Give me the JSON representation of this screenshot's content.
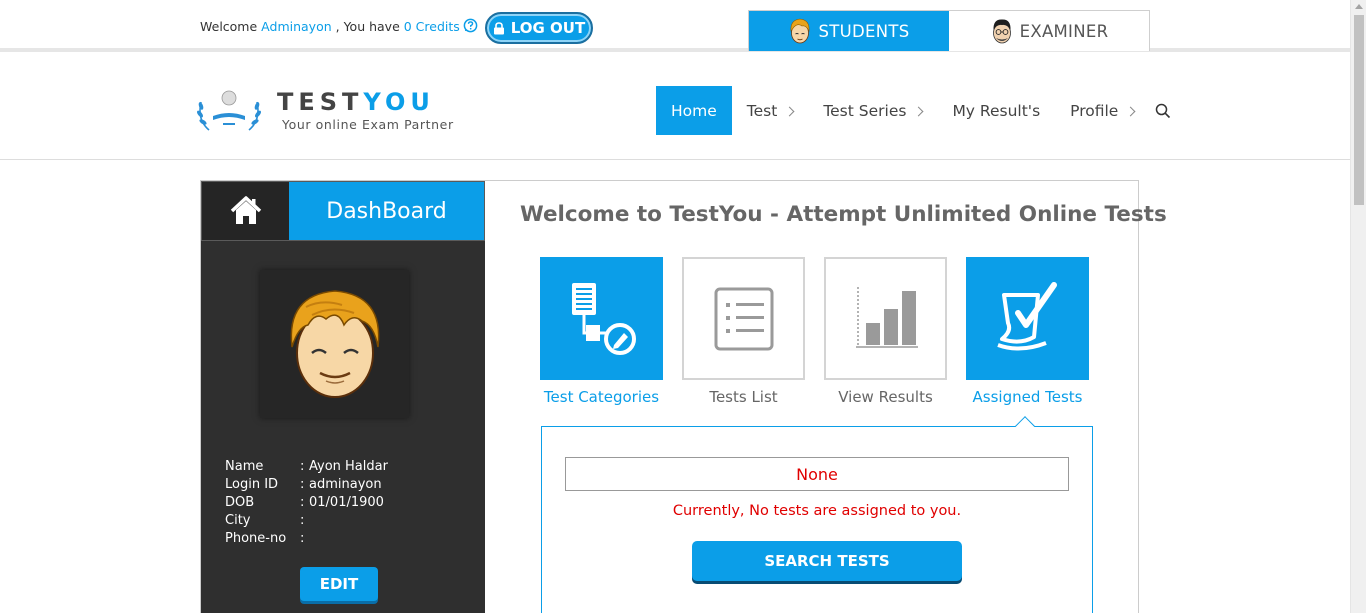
{
  "topbar": {
    "welcome_prefix": "Welcome",
    "username": "Adminayon",
    "have_text": ", You have",
    "credits": "0 Credits",
    "credits_suffix": ".",
    "logout_label": "LOG OUT"
  },
  "roles": {
    "students_label": "STUDENTS",
    "examiner_label": "EXAMINER"
  },
  "logo": {
    "brand_part1": "TEST",
    "brand_part2": "YOU",
    "tagline": "Your online Exam Partner"
  },
  "nav": {
    "items": [
      {
        "label": "Home"
      },
      {
        "label": "Test"
      },
      {
        "label": "Test Series"
      },
      {
        "label": "My Result's"
      },
      {
        "label": "Profile"
      }
    ]
  },
  "sidebar": {
    "title": "DashBoard",
    "profile": [
      {
        "label": "Name",
        "value": "Ayon Haldar"
      },
      {
        "label": "Login ID",
        "value": "adminayon"
      },
      {
        "label": "DOB",
        "value": "01/01/1900"
      },
      {
        "label": "City",
        "value": ""
      },
      {
        "label": "Phone-no",
        "value": ""
      }
    ],
    "separator": ":",
    "edit_label": "EDIT"
  },
  "main": {
    "title": "Welcome to TestYou - Attempt Unlimited Online Tests",
    "tiles": [
      {
        "label": "Test Categories",
        "icon": "test-categories-icon"
      },
      {
        "label": "Tests List",
        "icon": "tests-list-icon"
      },
      {
        "label": "View Results",
        "icon": "view-results-icon"
      },
      {
        "label": "Assigned Tests",
        "icon": "assigned-tests-icon"
      }
    ],
    "none_label": "None",
    "no_tests_message": "Currently, No tests are assigned to you.",
    "search_button_label": "SEARCH TESTS"
  },
  "colors": {
    "accent": "#0b9ee8",
    "sidebar_bg": "#2f2f2f",
    "error": "#e00000"
  }
}
